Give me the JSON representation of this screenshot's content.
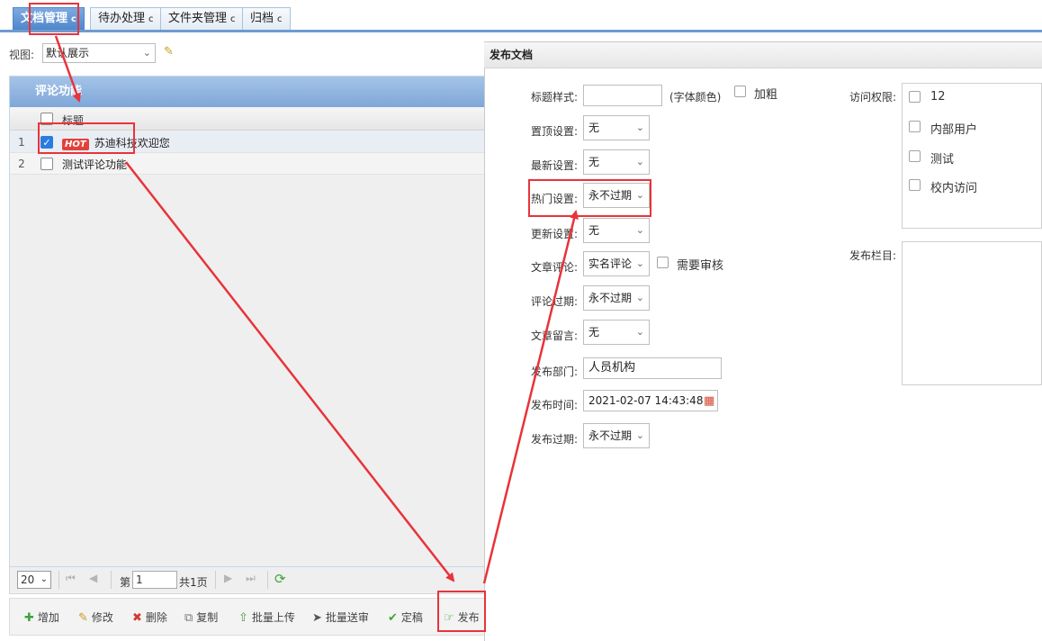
{
  "tabs": [
    {
      "label": "文档管理",
      "reload": "c",
      "active": true
    },
    {
      "label": "待办处理",
      "reload": "c",
      "active": false
    },
    {
      "label": "文件夹管理",
      "reload": "c",
      "active": false
    },
    {
      "label": "归档",
      "reload": "c",
      "active": false
    }
  ],
  "view": {
    "label": "视图:",
    "selected": "默认展示"
  },
  "grid": {
    "title": "评论功能",
    "column_title": "标题",
    "rows": [
      {
        "num": "1",
        "hot": "HOT",
        "title": "苏迪科技欢迎您",
        "checked": true
      },
      {
        "num": "2",
        "title": "测试评论功能",
        "checked": false
      }
    ]
  },
  "pager": {
    "page_size": "20",
    "page_label": "第",
    "page": "1",
    "total": "共1页"
  },
  "toolbar": {
    "add": "增加",
    "edit": "修改",
    "delete": "删除",
    "copy": "复制",
    "batch_upload": "批量上传",
    "batch_submit": "批量送审",
    "finalize": "定稿",
    "publish": "发布"
  },
  "form": {
    "title": "发布文档",
    "title_style_label": "标题样式:",
    "font_color_text": "(字体颜色)",
    "bold_label": "加粗",
    "pin_label": "置顶设置:",
    "pin_value": "无",
    "latest_label": "最新设置:",
    "latest_value": "无",
    "hot_label": "热门设置:",
    "hot_value": "永不过期",
    "update_label": "更新设置:",
    "update_value": "无",
    "comment_label": "文章评论:",
    "comment_value": "实名评论",
    "need_review": "需要审核",
    "comment_expire_label": "评论过期:",
    "comment_expire_value": "永不过期",
    "message_label": "文章留言:",
    "message_value": "无",
    "dept_label": "发布部门:",
    "dept_value": "人员机构",
    "time_label": "发布时间:",
    "time_value": "2021-02-07 14:43:48",
    "publish_expire_label": "发布过期:",
    "publish_expire_value": "永不过期",
    "access_label": "访问权限:",
    "access_options": [
      "12",
      "内部用户",
      "测试",
      "校内访问"
    ],
    "column_label": "发布栏目:"
  },
  "colors": {
    "annotation": "#e8333a",
    "accent": "#4f86cc"
  }
}
